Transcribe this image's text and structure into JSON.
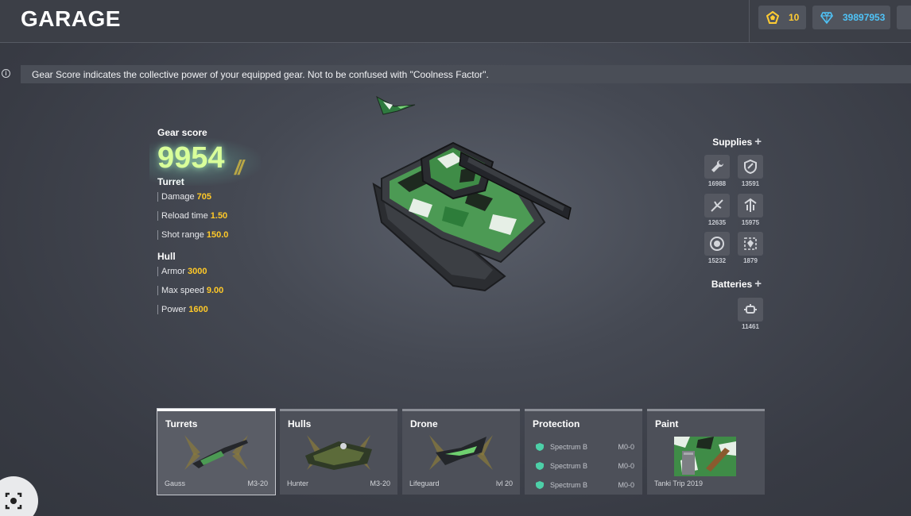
{
  "header": {
    "title": "GARAGE",
    "crystals": "10",
    "diamonds": "39897953"
  },
  "info": {
    "text": "Gear Score indicates the collective power of your equipped gear. Not to be confused with \"Coolness Factor\"."
  },
  "stats": {
    "gear_score_label": "Gear score",
    "gear_score_value": "9954",
    "turret": {
      "heading": "Turret",
      "rows": [
        {
          "label": "Damage",
          "value": "705"
        },
        {
          "label": "Reload time",
          "value": "1.50"
        },
        {
          "label": "Shot range",
          "value": "150.0"
        }
      ]
    },
    "hull": {
      "heading": "Hull",
      "rows": [
        {
          "label": "Armor",
          "value": "3000"
        },
        {
          "label": "Max speed",
          "value": "9.00"
        },
        {
          "label": "Power",
          "value": "1600"
        }
      ]
    }
  },
  "supplies": {
    "heading": "Supplies",
    "items": [
      {
        "icon": "repair-kit-icon",
        "count": "16988"
      },
      {
        "icon": "double-armor-icon",
        "count": "13591"
      },
      {
        "icon": "double-damage-icon",
        "count": "12635"
      },
      {
        "icon": "speed-boost-icon",
        "count": "15975"
      },
      {
        "icon": "mine-icon",
        "count": "15232"
      },
      {
        "icon": "gold-box-icon",
        "count": "1879"
      }
    ]
  },
  "batteries": {
    "heading": "Batteries",
    "count": "11461"
  },
  "cards": {
    "turrets": {
      "title": "Turrets",
      "name": "Gauss",
      "level": "M3-20"
    },
    "hulls": {
      "title": "Hulls",
      "name": "Hunter",
      "level": "M3-20"
    },
    "drone": {
      "title": "Drone",
      "name": "Lifeguard",
      "level": "lvl 20"
    },
    "protection": {
      "title": "Protection",
      "rows": [
        {
          "name": "Spectrum B",
          "level": "M0-0"
        },
        {
          "name": "Spectrum B",
          "level": "M0-0"
        },
        {
          "name": "Spectrum B",
          "level": "M0-0"
        }
      ]
    },
    "paint": {
      "title": "Paint",
      "name": "Tanki Trip 2019"
    }
  },
  "colors": {
    "accent_value": "#ffc928",
    "crystal": "#ffcc33",
    "diamond": "#4fc3f7",
    "protection_shield": "#4dd0a8"
  }
}
